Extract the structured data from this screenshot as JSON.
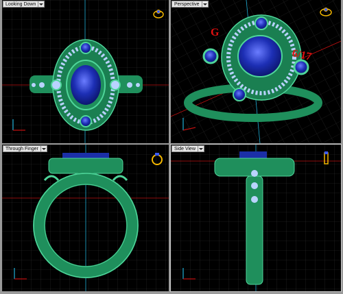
{
  "viewports": [
    {
      "id": "looking-down",
      "label": "Looking Down"
    },
    {
      "id": "perspective",
      "label": "Perspective"
    },
    {
      "id": "through-finger",
      "label": "Through Finger"
    },
    {
      "id": "side-view",
      "label": "Side View"
    }
  ],
  "overlay_text": {
    "left": "G",
    "right": "6/17"
  },
  "icons": {
    "ring_nav": "ring-navigation-icon",
    "axis": "axis-triad-icon"
  },
  "colors": {
    "background": "#000000",
    "grid": "#3a3a3a",
    "ring_metal": "#1f8f5c",
    "ring_highlight": "#4fd59a",
    "sapphire": "#1b2fa8",
    "diamond": "#b9d3ff",
    "axis_red": "#c01010",
    "axis_blue": "#1fb0d8",
    "engrave_text": "#e01010",
    "nav_gold": "#f5b800"
  }
}
